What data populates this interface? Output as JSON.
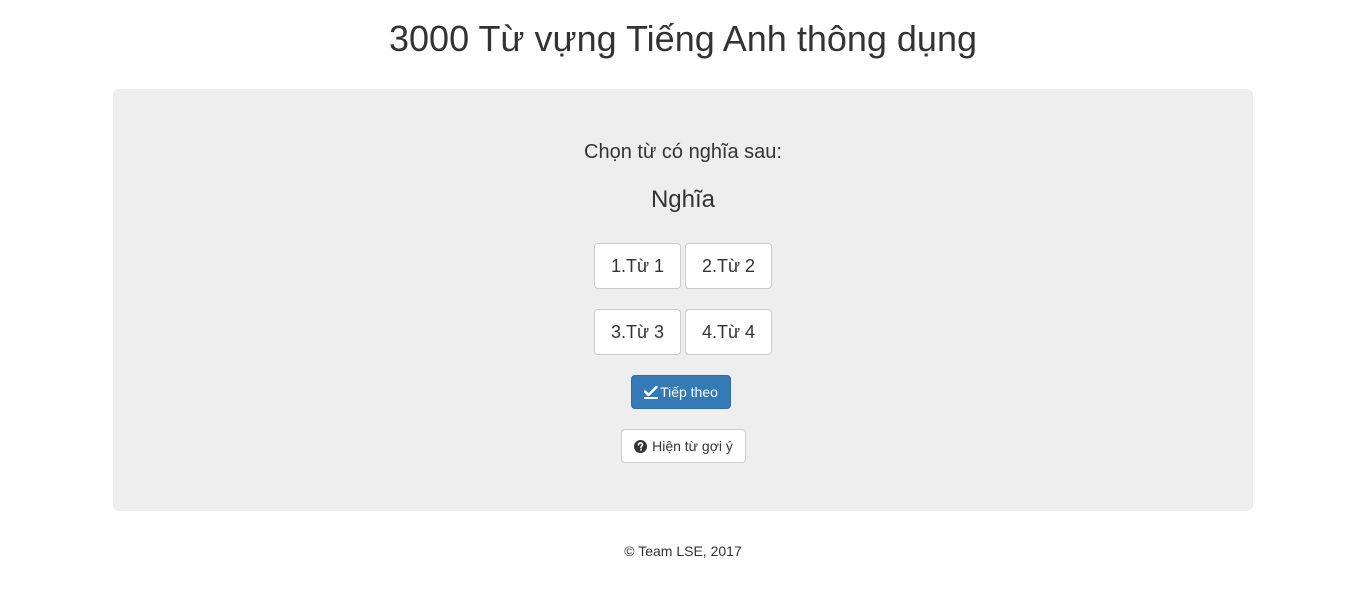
{
  "header": {
    "title": "3000 Từ vựng Tiếng Anh thông dụng"
  },
  "quiz": {
    "prompt": "Chọn từ có nghĩa sau:",
    "meaning": "Nghĩa",
    "choices": [
      "1.Từ 1",
      "2.Từ 2",
      "3.Từ 3",
      "4.Từ 4"
    ],
    "next_label": "Tiếp theo",
    "next_icon": "check-pencil-icon",
    "hint_label": "Hiện từ gợi ý",
    "hint_icon": "question-circle-icon"
  },
  "footer": {
    "text": "© Team LSE, 2017"
  },
  "colors": {
    "primary": "#337ab7",
    "panel_bg": "#eeeeee",
    "text": "#333333"
  }
}
